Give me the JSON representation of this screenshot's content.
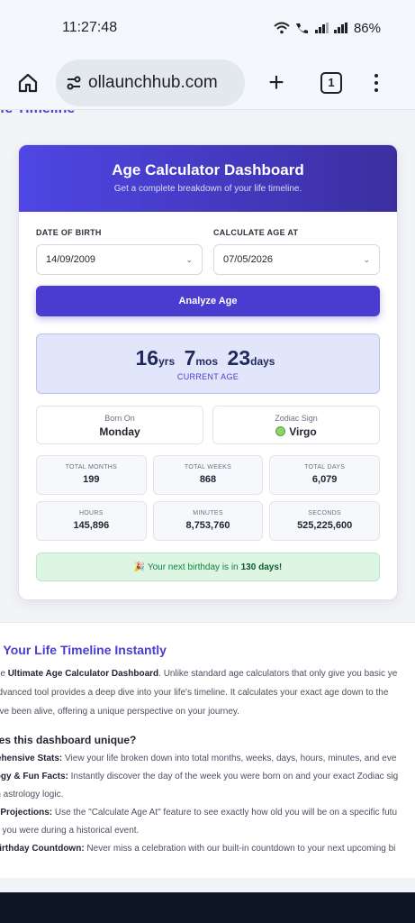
{
  "status_bar": {
    "time": "11:27:48",
    "battery": "86%"
  },
  "browser": {
    "url": "ollaunchhub.com",
    "tab_count": "1"
  },
  "page": {
    "peek_title": "fe Timeline"
  },
  "card": {
    "title": "Age Calculator Dashboard",
    "subtitle": "Get a complete breakdown of your life timeline.",
    "dob_label": "DATE OF BIRTH",
    "dob_value": "14/09/2009",
    "calc_label": "CALCULATE AGE AT",
    "calc_value": "07/05/2026",
    "analyze_label": "Analyze Age",
    "age": {
      "years": "16",
      "years_unit": "yrs",
      "months": "7",
      "months_unit": "mos",
      "days": "23",
      "days_unit": "days",
      "caption": "CURRENT AGE"
    },
    "born_on_label": "Born On",
    "born_on_value": "Monday",
    "zodiac_label": "Zodiac Sign",
    "zodiac_value": "Virgo",
    "stats": [
      {
        "label": "TOTAL MONTHS",
        "value": "199"
      },
      {
        "label": "TOTAL WEEKS",
        "value": "868"
      },
      {
        "label": "TOTAL DAYS",
        "value": "6,079"
      },
      {
        "label": "HOURS",
        "value": "145,896"
      },
      {
        "label": "MINUTES",
        "value": "8,753,760"
      },
      {
        "label": "SECONDS",
        "value": "525,225,600"
      }
    ],
    "birthday_prefix": "🎉 Your next birthday is in",
    "birthday_days": "130 days!"
  },
  "article": {
    "title": "e Your Life Timeline Instantly",
    "p1a": "the ",
    "p1b": "Ultimate Age Calculator Dashboard",
    "p1c": ". Unlike standard age calculators that only give you basic ye",
    "p2": " advanced tool provides a deep dive into your life's timeline. It calculates your exact age down to the",
    "p3": "u've been alive, offering a unique perspective on your journey.",
    "subhead": "kes this dashboard unique?",
    "items": [
      {
        "bold": "rehensive Stats:",
        "text": " View your life broken down into total months, weeks, days, hours, minutes, and eve"
      },
      {
        "bold": "logy & Fun Facts:",
        "text": " Instantly discover the day of the week you were born on and your exact Zodiac sig"
      },
      {
        "bold": "",
        "text": "rn astrology logic."
      },
      {
        "bold": "e Projections:",
        "text": " Use the \"Calculate Age At\" feature to see exactly how old you will be on a specific futu"
      },
      {
        "bold": "",
        "text": "ld you were during a historical event."
      },
      {
        "bold": "Birthday Countdown:",
        "text": " Never miss a celebration with our built-in countdown to your next upcoming bi"
      }
    ]
  }
}
